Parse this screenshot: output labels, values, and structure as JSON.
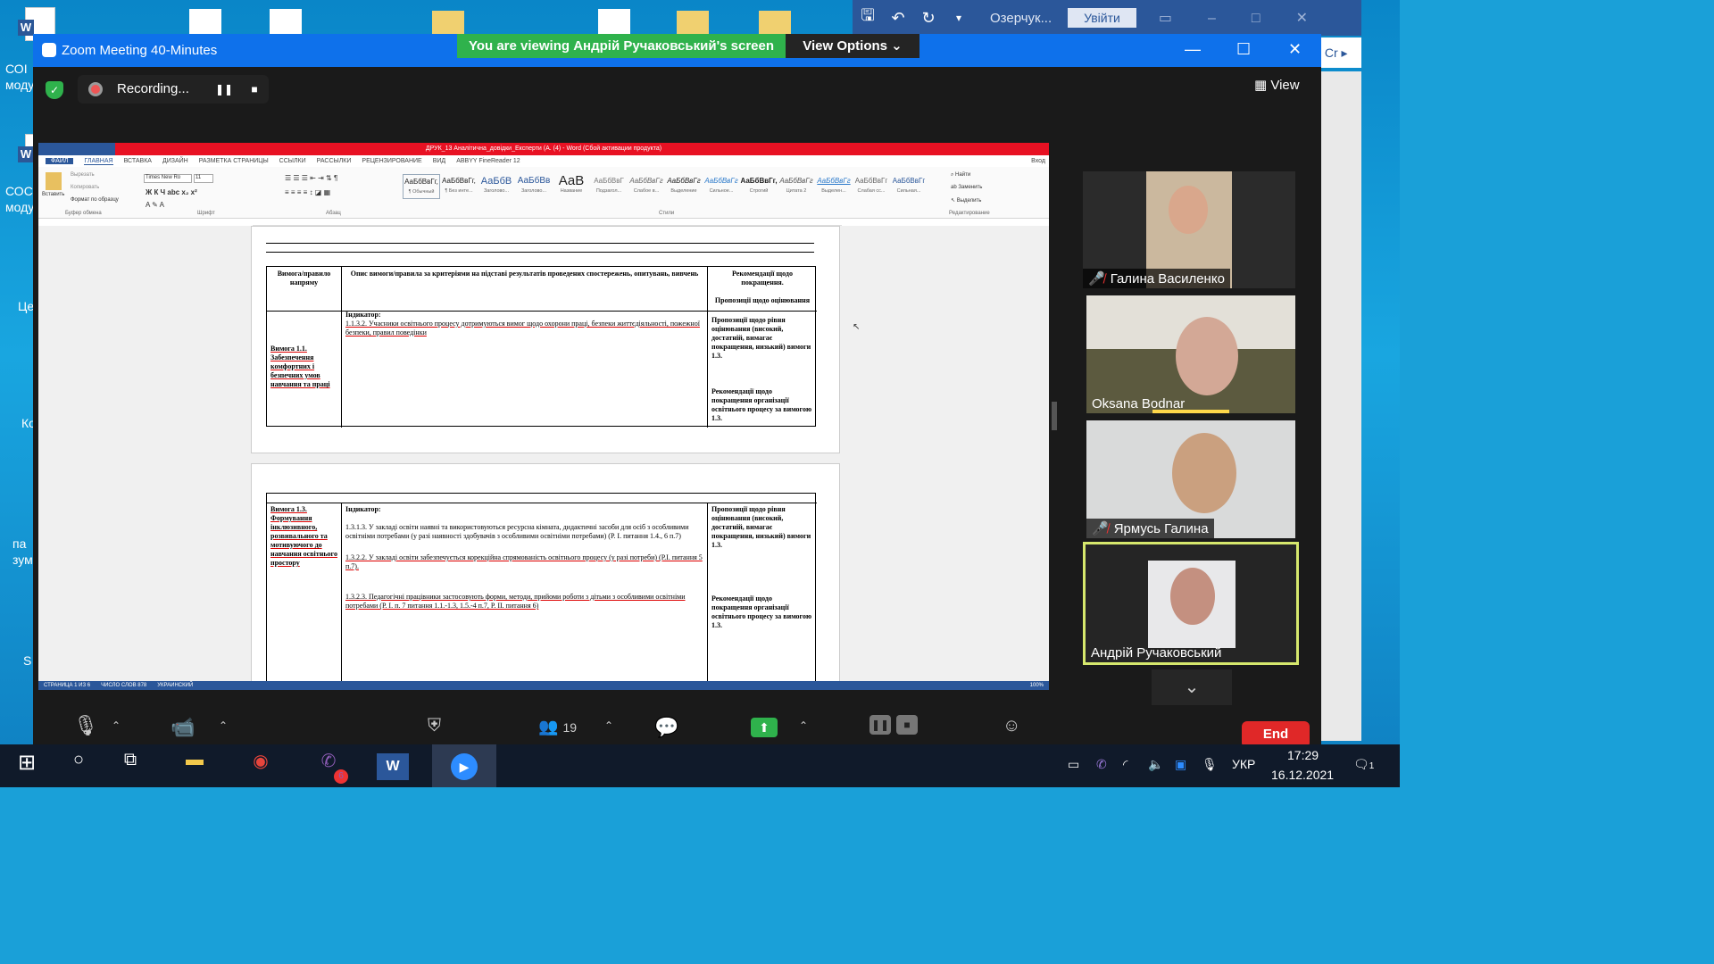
{
  "desktop": {
    "icons": [
      {
        "label": "СОІ моду"
      },
      {
        "label": "СОС моду"
      },
      {
        "label": "Це"
      },
      {
        "label": "Ко"
      },
      {
        "label": "па зум"
      },
      {
        "label": "S"
      }
    ]
  },
  "word_bg": {
    "user": "Озерчук...",
    "login": "Увійти"
  },
  "zoom": {
    "title": "Zoom Meeting 40-Minutes",
    "banner": "You are viewing Андрій Ручаковський's screen",
    "view_options": "View Options",
    "recording": "Recording...",
    "view": "View",
    "participants_count": "19",
    "end": "End"
  },
  "word": {
    "title": "ДРУК_13 Аналітична_довідки_Експерти (А. (4) - Word (Сбой активации продукта)",
    "tabs": [
      "ФАЙЛ",
      "ГЛАВНАЯ",
      "ВСТАВКА",
      "ДИЗАЙН",
      "РАЗМЕТКА СТРАНИЦЫ",
      "ССЫЛКИ",
      "РАССЫЛКИ",
      "РЕЦЕНЗИРОВАНИЕ",
      "ВИД",
      "ABBYY FineReader 12"
    ],
    "login": "Вход",
    "clipboard": {
      "paste": "Вставить",
      "cut": "Вырезать",
      "copy": "Копировать",
      "format": "Формат по образцу",
      "group": "Буфер обмена"
    },
    "font": {
      "name": "Times New Ro",
      "size": "11",
      "group": "Шрифт"
    },
    "paragraph_group": "Абзац",
    "styles_group": "Стили",
    "editing": {
      "find": "Найти",
      "replace": "Заменить",
      "select": "Выделить",
      "group": "Редактирование"
    },
    "styles": [
      {
        "sample": "АаБбВвГг,",
        "name": "¶ Обычный"
      },
      {
        "sample": "АаБбВвГг,",
        "name": "¶ Без инте..."
      },
      {
        "sample": "АаБбВ",
        "name": "Заголово..."
      },
      {
        "sample": "АаБбВв",
        "name": "Заголово..."
      },
      {
        "sample": "АаВ",
        "name": "Название"
      },
      {
        "sample": "АаБбВвГ",
        "name": "Подзагол..."
      },
      {
        "sample": "АаБбВвГг",
        "name": "Слабое в..."
      },
      {
        "sample": "АаБбВвГг",
        "name": "Выделение"
      },
      {
        "sample": "АаБбВвГг",
        "name": "Сильное..."
      },
      {
        "sample": "АаБбВвГг,",
        "name": "Строгий"
      },
      {
        "sample": "АаБбВвГг",
        "name": "Цитата 2"
      },
      {
        "sample": "АаБбВвГг",
        "name": "Выделен..."
      },
      {
        "sample": "АаБбВвГг",
        "name": "Слабая сс..."
      },
      {
        "sample": "АаБбВвГг",
        "name": "Сильная..."
      }
    ],
    "table1": {
      "h1": "Вимога/правило напряму",
      "h2": "Опис вимоги/правила за критеріями на підставі результатів проведених спостережень, опитувань, вивчень",
      "h3a": "Рекомендації щодо покращення.",
      "h3b": "Пропозиції щодо оцінювання",
      "r1": "Вимога 1.1. Забезпечення комфортних і безпечних умов навчання та праці",
      "r2a": "Індикатор:",
      "r2b": "1.1.3.2. Учасники освітнього процесу дотримуються вимог щодо охорони праці, безпеки життєдіяльності, пожежної безпеки, правил поведінки",
      "r3a": "Пропозиції щодо рівня оцінювання (високий, достатній, вимагає покращення, низький) вимоги 1.3.",
      "r3b": "Рекомендації щодо покращення організації освітнього процесу за вимогою 1.3."
    },
    "table2": {
      "r1": "Вимога 1.3. Формування інклюзивного, розвивального та мотивуючого до навчання освітнього простору",
      "r2a": "Індикатор:",
      "r2b": "1.3.1.3. У закладі освіти наявні та використовуються ресурсна кімната, дидактичні засоби для осіб з особливими освітніми потребами (у разі наявності здобувачів з особливими освітніми потребами) (Р. І. питання 1.4., 6 п.7)",
      "r2c": "1.3.2.2. У закладі освіти забезпечується корекційна спрямованість освітнього процесу (у разі потреби) (Р.І. питання 5 п.7).",
      "r2d": "1.3.2.3. Педагогічні працівники застосовують форми, методи, прийоми роботи з дітьми з особливими освітніми потребами (Р. І. п. 7 питання 1.1.-1.3, 1.5.-4 п.7, Р. ІІ. питання 6)",
      "r3a": "Пропозиції щодо рівня оцінювання (високий, достатній, вимагає покращення, низький) вимоги 1.3.",
      "r3b": "Рекомендації щодо покращення організації освітнього процесу за вимогою 1.3."
    },
    "status": {
      "page": "СТРАНИЦА 1 ИЗ 6",
      "words": "ЧИСЛО СЛОВ 878",
      "lang": "УКРАИНСКИЙ",
      "zoom": "100%"
    }
  },
  "participants": [
    {
      "name": "Галина Василенко",
      "muted": true
    },
    {
      "name": "Oksana Bodnar",
      "muted": false
    },
    {
      "name": "Ярмусь Галина",
      "muted": true
    },
    {
      "name": "Андрій Ручаковський",
      "muted": false
    }
  ],
  "taskbar": {
    "lang": "УКР",
    "time": "17:29",
    "date": "16.12.2021",
    "viber_badge": "6",
    "notif": "1"
  }
}
